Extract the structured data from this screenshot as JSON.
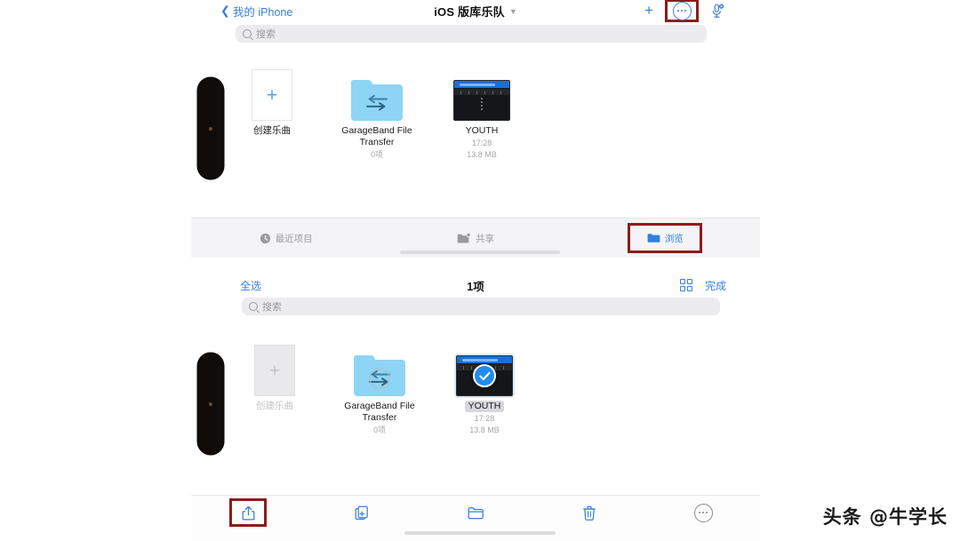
{
  "top_panel": {
    "nav": {
      "back_label": "我的 iPhone",
      "back_icon": "chevron-left-icon",
      "title": "iOS 版库乐队",
      "title_chevron_icon": "chevron-down-icon",
      "add_icon": "plus-icon",
      "add_label": "+",
      "more_icon": "ellipsis-circle-icon",
      "mic_icon": "microphone-add-icon"
    },
    "search": {
      "placeholder": "搜索",
      "icon": "search-icon"
    },
    "files": [
      {
        "name": "创建乐曲",
        "kind": "new-song-tile",
        "icon": "plus-icon",
        "meta1": "",
        "meta2": "",
        "selected": false,
        "dim": false
      },
      {
        "name": "GarageBand File Transfer",
        "kind": "folder",
        "icon": "folder-transfer-icon",
        "meta1": "0项",
        "meta2": "",
        "selected": false,
        "dim": false
      },
      {
        "name": "YOUTH",
        "kind": "project",
        "icon": "garageband-project-thumbnail",
        "meta1": "17:28",
        "meta2": "13.8 MB",
        "selected": false,
        "dim": false
      }
    ]
  },
  "tabbar": {
    "tabs": [
      {
        "label": "最近项目",
        "icon": "clock-icon",
        "active": false,
        "highlighted": false
      },
      {
        "label": "共享",
        "icon": "shared-folder-icon",
        "active": false,
        "highlighted": false
      },
      {
        "label": "浏览",
        "icon": "folder-icon",
        "active": true,
        "highlighted": true
      }
    ]
  },
  "bottom_panel": {
    "toolbar": {
      "select_all_label": "全选",
      "count_label": "1项",
      "grid_icon": "grid-view-icon",
      "done_label": "完成"
    },
    "search": {
      "placeholder": "搜索",
      "icon": "search-icon"
    },
    "files": [
      {
        "name": "创建乐曲",
        "kind": "new-song-tile",
        "icon": "plus-icon",
        "meta1": "",
        "meta2": "",
        "selected": false,
        "dim": true
      },
      {
        "name": "GarageBand File Transfer",
        "kind": "folder",
        "icon": "folder-transfer-icon",
        "meta1": "0项",
        "meta2": "",
        "selected": false,
        "dim": false
      },
      {
        "name": "YOUTH",
        "kind": "project",
        "icon": "garageband-project-thumbnail",
        "meta1": "17:28",
        "meta2": "13.8 MB",
        "selected": true,
        "dim": false
      }
    ]
  },
  "bottom_toolbar": {
    "items": [
      {
        "icon": "share-icon",
        "highlighted": true
      },
      {
        "icon": "duplicate-icon",
        "highlighted": false
      },
      {
        "icon": "move-to-folder-icon",
        "highlighted": false
      },
      {
        "icon": "trash-icon",
        "highlighted": false
      },
      {
        "icon": "more-circle-icon",
        "highlighted": false
      }
    ]
  },
  "watermark": {
    "text": "头条 @牛学长"
  },
  "colors": {
    "accent_blue": "#3a7fdc",
    "tab_active_blue": "#2f7fe0",
    "annotation_red": "#8d1b1b",
    "folder_blue": "#8ed4f5",
    "selection_blue": "#1f8cf0",
    "muted_gray": "#9b9b9f",
    "tabbar_bg": "#f4f4f6"
  }
}
